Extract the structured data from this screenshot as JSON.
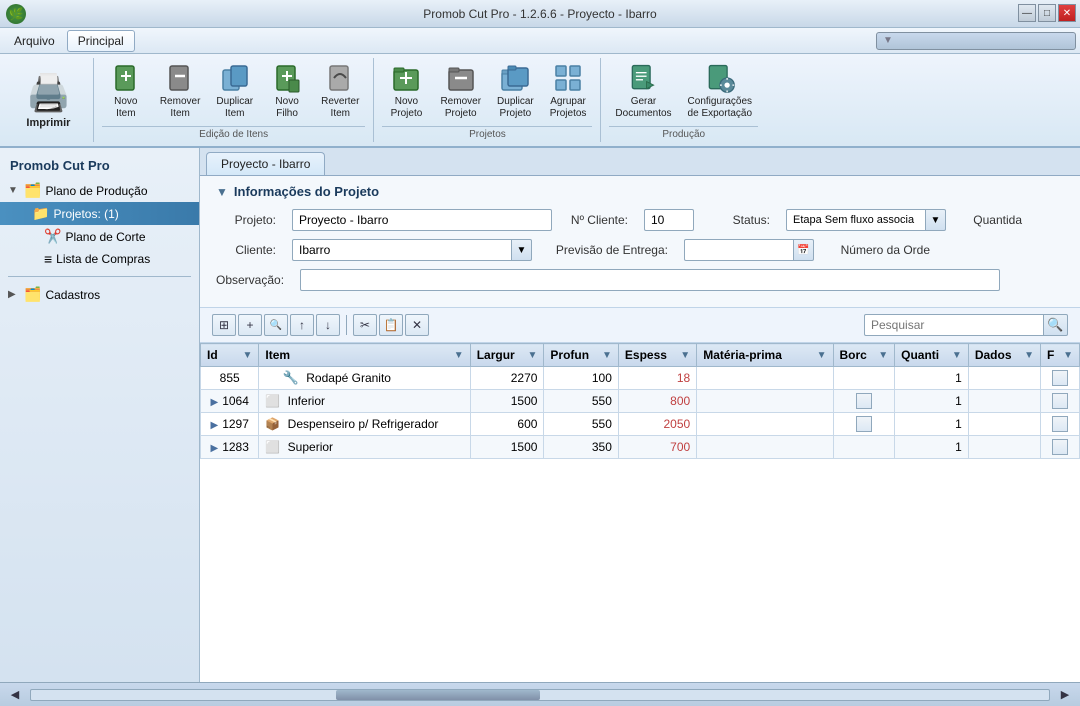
{
  "window": {
    "title": "Promob Cut Pro - 1.2.6.6 - Proyecto - Ibarro",
    "controls": [
      "—",
      "□",
      "✕"
    ]
  },
  "menu": {
    "items": [
      "Arquivo",
      "Principal"
    ]
  },
  "ribbon": {
    "groups": [
      {
        "name": "print",
        "label": "",
        "buttons": [
          {
            "id": "imprimir",
            "label": "Imprimir",
            "icon": "🖨️",
            "large": true
          }
        ]
      },
      {
        "name": "edicao-itens",
        "label": "Edição de Itens",
        "buttons": [
          {
            "id": "novo-item",
            "label": "Novo\nItem",
            "icon": "📄"
          },
          {
            "id": "remover-item",
            "label": "Remover\nItem",
            "icon": "🗑️"
          },
          {
            "id": "duplicar-item",
            "label": "Duplicar\nItem",
            "icon": "📋"
          },
          {
            "id": "novo-filho",
            "label": "Novo\nFilho",
            "icon": "📄"
          },
          {
            "id": "reverter-item",
            "label": "Reverter\nItem",
            "icon": "↩️"
          }
        ]
      },
      {
        "name": "projetos",
        "label": "Projetos",
        "buttons": [
          {
            "id": "novo-projeto",
            "label": "Novo\nProjeto",
            "icon": "📁"
          },
          {
            "id": "remover-projeto",
            "label": "Remover\nProjeto",
            "icon": "🗑️"
          },
          {
            "id": "duplicar-projeto",
            "label": "Duplicar\nProjeto",
            "icon": "📋"
          },
          {
            "id": "agrupar-projetos",
            "label": "Agrupar\nProjetos",
            "icon": "📦"
          }
        ]
      },
      {
        "name": "producao",
        "label": "Produção",
        "buttons": [
          {
            "id": "gerar-documentos",
            "label": "Gerar\nDocumentos",
            "icon": "📊"
          },
          {
            "id": "config-exportacao",
            "label": "Configurações\nde Exportação",
            "icon": "⚙️"
          }
        ]
      }
    ]
  },
  "sidebar": {
    "title": "Promob Cut Pro",
    "tree": [
      {
        "id": "plano-producao",
        "label": "Plano de Produção",
        "icon": "🗂️",
        "expanded": true,
        "indent": 0
      },
      {
        "id": "projetos",
        "label": "Projetos: (1)",
        "icon": "📁",
        "selected": true,
        "indent": 1
      },
      {
        "id": "plano-corte",
        "label": "Plano de Corte",
        "icon": "✂️",
        "indent": 2
      },
      {
        "id": "lista-compras",
        "label": "Lista de Compras",
        "icon": "🛒",
        "indent": 2
      },
      {
        "id": "cadastros",
        "label": "Cadastros",
        "icon": "🗂️",
        "indent": 0
      }
    ]
  },
  "content_tab": "Proyecto - Ibarro",
  "project_info": {
    "section_title": "Informações do Projeto",
    "fields": {
      "projeto_label": "Projeto:",
      "projeto_value": "Proyecto - Ibarro",
      "no_cliente_label": "Nº Cliente:",
      "no_cliente_value": "10",
      "status_label": "Status:",
      "status_value": "Etapa Sem fluxo associa",
      "quantidade_label": "Quantida",
      "cliente_label": "Cliente:",
      "cliente_value": "Ibarro",
      "previsao_label": "Previsão de Entrega:",
      "previsao_value": "",
      "numero_ordem_label": "Número da Orde",
      "observacao_label": "Observação:",
      "observacao_value": ""
    }
  },
  "toolbar": {
    "buttons": [
      "⊞",
      "+",
      "🔍",
      "↑",
      "↓",
      "✂️",
      "📋",
      "✕"
    ],
    "search_placeholder": "Pesquisar"
  },
  "table": {
    "columns": [
      {
        "id": "id",
        "label": "Id"
      },
      {
        "id": "item",
        "label": "Item"
      },
      {
        "id": "largur",
        "label": "Largur"
      },
      {
        "id": "profun",
        "label": "Profun"
      },
      {
        "id": "espess",
        "label": "Espess"
      },
      {
        "id": "materia-prima",
        "label": "Matéria-prima"
      },
      {
        "id": "borc",
        "label": "Borc"
      },
      {
        "id": "quanti",
        "label": "Quanti"
      },
      {
        "id": "dados",
        "label": "Dados"
      },
      {
        "id": "f",
        "label": "F"
      }
    ],
    "rows": [
      {
        "id": "855",
        "expand": false,
        "icon": "🪛",
        "item": "Rodapé Granito",
        "largur": "2270",
        "profun": "100",
        "espess": "18",
        "materia": "",
        "borc": "",
        "quanti": "1",
        "dados": "",
        "f": false
      },
      {
        "id": "1064",
        "expand": true,
        "icon": "⬜",
        "item": "Inferior",
        "largur": "1500",
        "profun": "550",
        "espess": "800",
        "materia": "",
        "borc": "☐",
        "quanti": "1",
        "dados": "",
        "f": false
      },
      {
        "id": "1297",
        "expand": true,
        "icon": "📦",
        "item": "Despenseiro p/ Refrigerador",
        "largur": "600",
        "profun": "550",
        "espess": "2050",
        "materia": "",
        "borc": "☐",
        "quanti": "1",
        "dados": "",
        "f": false
      },
      {
        "id": "1283",
        "expand": true,
        "icon": "⬜",
        "item": "Superior",
        "largur": "1500",
        "profun": "350",
        "espess": "700",
        "materia": "",
        "borc": "",
        "quanti": "1",
        "dados": "",
        "f": false
      }
    ]
  },
  "status_bar": {}
}
